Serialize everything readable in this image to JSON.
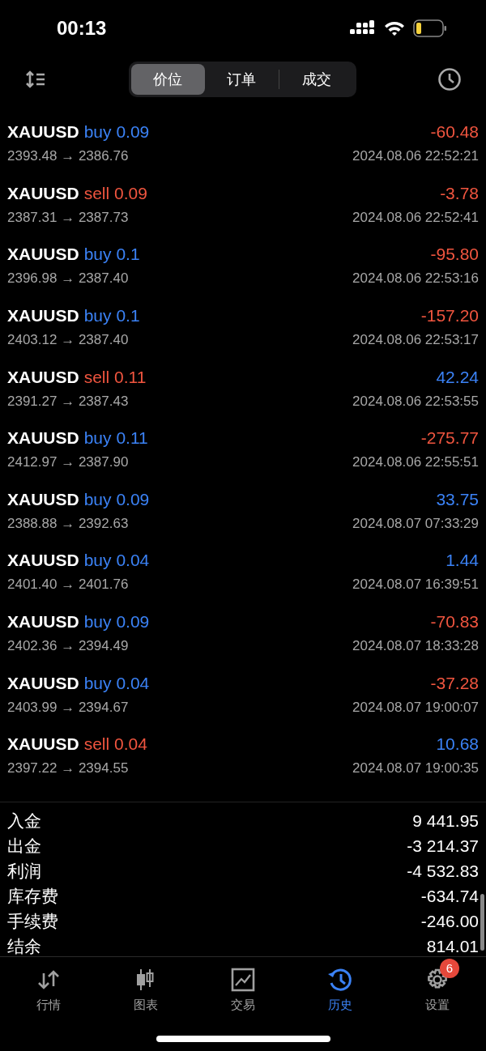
{
  "status_bar": {
    "time": "00:13"
  },
  "segments": [
    {
      "label": "价位",
      "selected": true
    },
    {
      "label": "订单",
      "selected": false
    },
    {
      "label": "成交",
      "selected": false
    }
  ],
  "deals": [
    {
      "symbol": "XAUUSD",
      "kind": "buy",
      "side": "buy",
      "volume": "0.09",
      "prices": "2393.48 → 2386.76",
      "profit": "-60.48",
      "gain": false,
      "time": "2024.08.06 22:52:21"
    },
    {
      "symbol": "XAUUSD",
      "kind": "sell",
      "side": "sell",
      "volume": "0.09",
      "prices": "2387.31 → 2387.73",
      "profit": "-3.78",
      "gain": false,
      "time": "2024.08.06 22:52:41"
    },
    {
      "symbol": "XAUUSD",
      "kind": "buy",
      "side": "buy",
      "volume": "0.1",
      "prices": "2396.98 → 2387.40",
      "profit": "-95.80",
      "gain": false,
      "time": "2024.08.06 22:53:16"
    },
    {
      "symbol": "XAUUSD",
      "kind": "buy",
      "side": "buy",
      "volume": "0.1",
      "prices": "2403.12 → 2387.40",
      "profit": "-157.20",
      "gain": false,
      "time": "2024.08.06 22:53:17"
    },
    {
      "symbol": "XAUUSD",
      "kind": "sell",
      "side": "sell",
      "volume": "0.11",
      "prices": "2391.27 → 2387.43",
      "profit": "42.24",
      "gain": true,
      "time": "2024.08.06 22:53:55"
    },
    {
      "symbol": "XAUUSD",
      "kind": "buy",
      "side": "buy",
      "volume": "0.11",
      "prices": "2412.97 → 2387.90",
      "profit": "-275.77",
      "gain": false,
      "time": "2024.08.06 22:55:51"
    },
    {
      "symbol": "XAUUSD",
      "kind": "buy",
      "side": "buy",
      "volume": "0.09",
      "prices": "2388.88 → 2392.63",
      "profit": "33.75",
      "gain": true,
      "time": "2024.08.07 07:33:29"
    },
    {
      "symbol": "XAUUSD",
      "kind": "buy",
      "side": "buy",
      "volume": "0.04",
      "prices": "2401.40 → 2401.76",
      "profit": "1.44",
      "gain": true,
      "time": "2024.08.07 16:39:51"
    },
    {
      "symbol": "XAUUSD",
      "kind": "buy",
      "side": "buy",
      "volume": "0.09",
      "prices": "2402.36 → 2394.49",
      "profit": "-70.83",
      "gain": false,
      "time": "2024.08.07 18:33:28"
    },
    {
      "symbol": "XAUUSD",
      "kind": "buy",
      "side": "buy",
      "volume": "0.04",
      "prices": "2403.99 → 2394.67",
      "profit": "-37.28",
      "gain": false,
      "time": "2024.08.07 19:00:07"
    },
    {
      "symbol": "XAUUSD",
      "kind": "sell",
      "side": "sell",
      "volume": "0.04",
      "prices": "2397.22 → 2394.55",
      "profit": "10.68",
      "gain": true,
      "time": "2024.08.07 19:00:35"
    }
  ],
  "summary": [
    {
      "label": "入金",
      "value": "9 441.95"
    },
    {
      "label": "出金",
      "value": "-3 214.37"
    },
    {
      "label": "利润",
      "value": "-4 532.83"
    },
    {
      "label": "库存费",
      "value": "-634.74"
    },
    {
      "label": "手续费",
      "value": "-246.00"
    },
    {
      "label": "结余",
      "value": "814.01"
    }
  ],
  "tab_bar": [
    {
      "kind": "quotes",
      "label": "行情",
      "selected": false
    },
    {
      "kind": "chart",
      "label": "图表",
      "selected": false
    },
    {
      "kind": "trade",
      "label": "交易",
      "selected": false
    },
    {
      "kind": "history",
      "label": "历史",
      "selected": true
    },
    {
      "kind": "settings",
      "label": "设置",
      "selected": false,
      "badge": "6"
    }
  ]
}
